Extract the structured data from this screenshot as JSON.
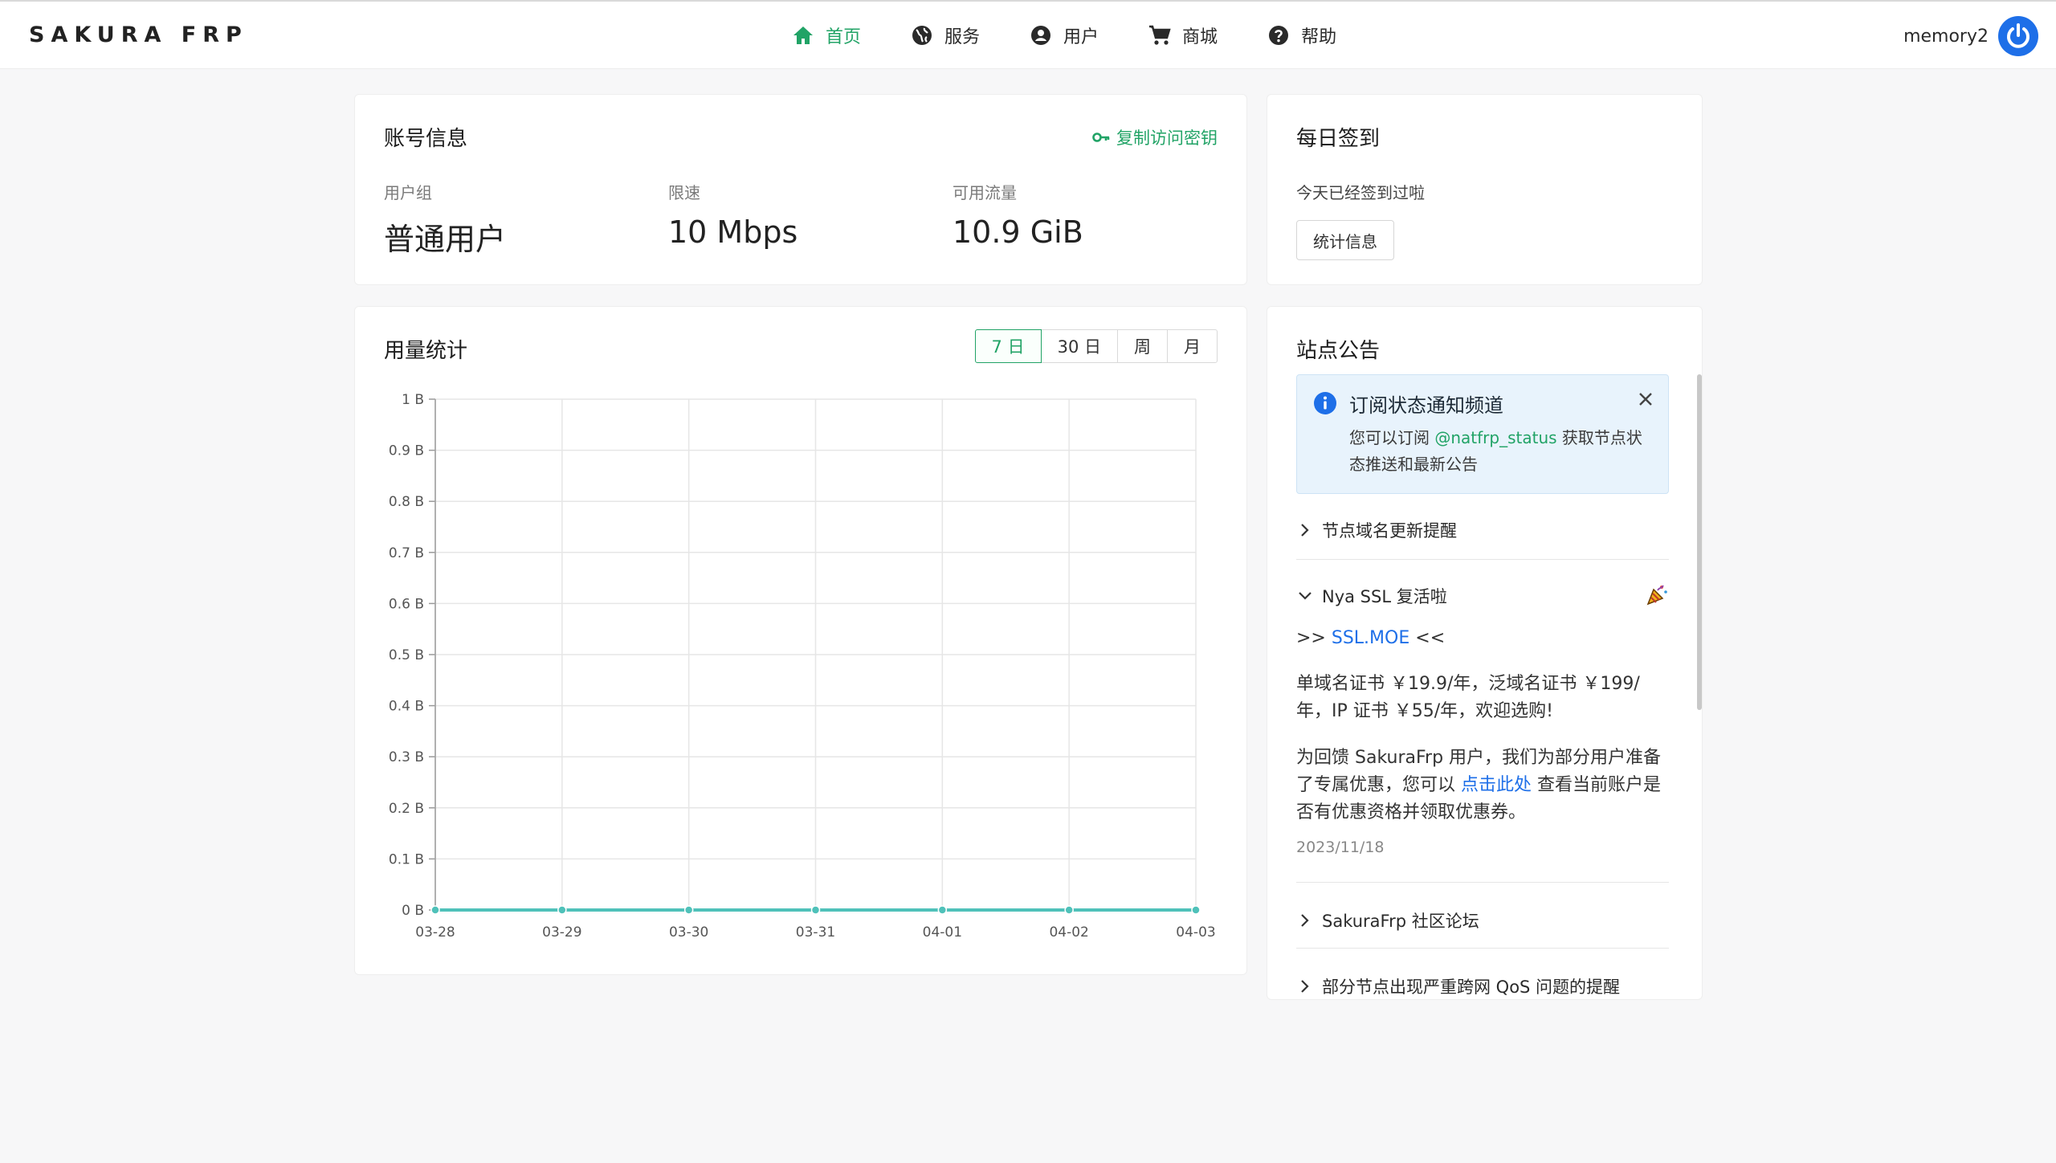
{
  "brand": "SAKURA FRP",
  "nav": [
    {
      "label": "首页",
      "icon": "home-icon",
      "active": true
    },
    {
      "label": "服务",
      "icon": "globe-icon",
      "active": false
    },
    {
      "label": "用户",
      "icon": "user-circle-icon",
      "active": false
    },
    {
      "label": "商城",
      "icon": "cart-icon",
      "active": false
    },
    {
      "label": "帮助",
      "icon": "help-icon",
      "active": false
    }
  ],
  "user": {
    "name": "memory2"
  },
  "account": {
    "title": "账号信息",
    "copy_key": "复制访问密钥",
    "stats": [
      {
        "label": "用户组",
        "value": "普通用户"
      },
      {
        "label": "限速",
        "value": "10 Mbps"
      },
      {
        "label": "可用流量",
        "value": "10.9 GiB"
      }
    ]
  },
  "signin": {
    "title": "每日签到",
    "status": "今天已经签到过啦",
    "stats_button": "统计信息"
  },
  "usage": {
    "title": "用量统计",
    "ranges": [
      "7 日",
      "30 日",
      "周",
      "月"
    ],
    "active_range": "7 日"
  },
  "chart_data": {
    "type": "line",
    "x": [
      "03-28",
      "03-29",
      "03-30",
      "03-31",
      "04-01",
      "04-02",
      "04-03"
    ],
    "series": [
      {
        "values": [
          0,
          0,
          0,
          0,
          0,
          0,
          0
        ],
        "color": "#4fc1b9"
      }
    ],
    "y_ticks": [
      "0 B",
      "0.1 B",
      "0.2 B",
      "0.3 B",
      "0.4 B",
      "0.5 B",
      "0.6 B",
      "0.7 B",
      "0.8 B",
      "0.9 B",
      "1 B"
    ],
    "ylim": [
      0,
      1
    ],
    "grid": true
  },
  "notice": {
    "title": "站点公告",
    "alert": {
      "title": "订阅状态通知频道",
      "body_pre": "您可以订阅 ",
      "body_link": "@natfrp_status",
      "body_post": " 获取节点状态推送和最新公告"
    },
    "items": [
      {
        "title": "节点域名更新提醒",
        "expanded": false
      },
      {
        "title": "Nya SSL 复活啦",
        "expanded": true
      },
      {
        "title": "SakuraFrp 社区论坛",
        "expanded": false
      },
      {
        "title": "部分节点出现严重跨网 QoS 问题的提醒",
        "expanded": false
      }
    ],
    "ssl": {
      "prefix": ">> ",
      "link": "SSL.MOE",
      "suffix": " <<",
      "price_text": "单域名证书 ￥19.9/年，泛域名证书 ￥199/年，IP 证书 ￥55/年，欢迎选购!",
      "offer_pre": "为回馈 SakuraFrp 用户，我们为部分用户准备了专属优惠，您可以 ",
      "offer_link": "点击此处",
      "offer_post": " 查看当前账户是否有优惠资格并领取优惠券。",
      "date": "2023/11/18"
    }
  }
}
